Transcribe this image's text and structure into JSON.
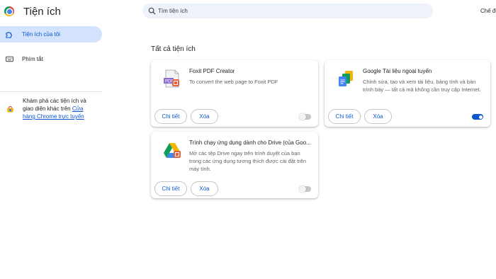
{
  "header": {
    "title": "Tiện ích",
    "search_placeholder": "Tìm tiện ích",
    "developer_mode_label": "Chế độ"
  },
  "sidebar": {
    "items": [
      {
        "label": "Tiện ích của tôi",
        "icon": "puzzle-icon",
        "active": true
      },
      {
        "label": "Phím tắt",
        "icon": "keyboard-icon",
        "active": false
      }
    ],
    "explore": {
      "text": "Khám phá các tiện ích và giao diện khác trên ",
      "link_label": "Cửa hàng Chrome trực tuyến",
      "icon": "webstore-icon"
    }
  },
  "main": {
    "section_title": "Tất cả tiện ích",
    "extensions": [
      {
        "name": "Foxit PDF Creator",
        "description": "To convert the web page to Foxit PDF",
        "details_label": "Chi tiết",
        "remove_label": "Xóa",
        "enabled": false,
        "icon": "foxit-pdf-icon"
      },
      {
        "name": "Google Tài liệu ngoại tuyến",
        "description": "Chỉnh sửa, tạo và xem tài liệu, bảng tính và bản trình bày — tất cả mà không cần truy cập Internet.",
        "details_label": "Chi tiết",
        "remove_label": "Xóa",
        "enabled": true,
        "icon": "google-docs-icon"
      },
      {
        "name": "Trình chạy ứng dụng dành cho Drive (của Goo...",
        "description": "Mở các tệp Drive ngay trên trình duyệt của bạn trong các ứng dụng tương thích được cài đặt trên máy tính.",
        "details_label": "Chi tiết",
        "remove_label": "Xóa",
        "enabled": false,
        "icon": "google-drive-icon"
      }
    ]
  },
  "colors": {
    "accent": "#0b57d0",
    "active_bg": "#d3e3fd",
    "search_bg": "#eef2f9"
  }
}
